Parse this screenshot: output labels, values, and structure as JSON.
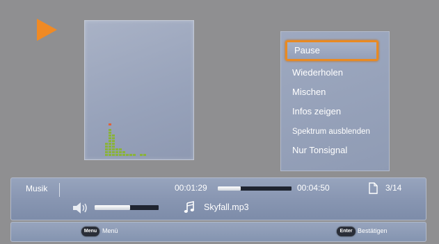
{
  "menu": {
    "items": [
      {
        "label": "Pause",
        "selected": true
      },
      {
        "label": "Wiederholen"
      },
      {
        "label": "Mischen"
      },
      {
        "label": "Infos zeigen"
      },
      {
        "label": "Spektrum ausblenden"
      },
      {
        "label": "Nur Tonsignal"
      }
    ]
  },
  "status": {
    "category": "Musik",
    "elapsed": "00:01:29",
    "total": "00:04:50",
    "progress_fraction": 0.31,
    "track_position": "3/14",
    "volume_fraction": 0.55,
    "filename": "Skyfall.mp3"
  },
  "help": {
    "menu_key": "Menu",
    "menu_label": "Menü",
    "enter_key": "Enter",
    "enter_label": "Bestätigen"
  },
  "colors": {
    "accent": "#e98a22",
    "play_indicator": "#f08a24",
    "spectrum_bars": "#8ab33a",
    "spectrum_peak": "#e0623a"
  }
}
